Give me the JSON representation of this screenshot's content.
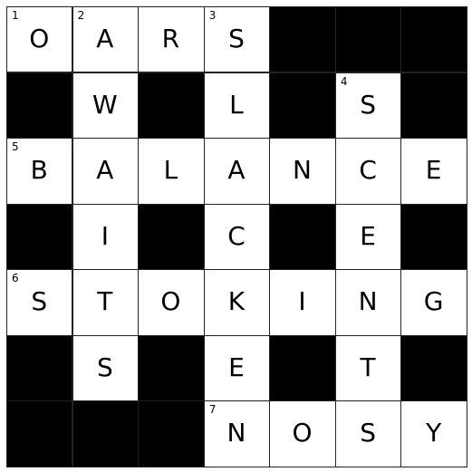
{
  "puzzle": {
    "rows": [
      "OARS###",
      "#W#L#S#",
      "BALANCE",
      "#I#C#E#",
      "STOKING",
      "#S#E#T#",
      "###NOSY"
    ],
    "numbers": [
      {
        "row": 0,
        "col": 0,
        "n": "1"
      },
      {
        "row": 0,
        "col": 1,
        "n": "2"
      },
      {
        "row": 0,
        "col": 3,
        "n": "3"
      },
      {
        "row": 1,
        "col": 5,
        "n": "4"
      },
      {
        "row": 2,
        "col": 0,
        "n": "5"
      },
      {
        "row": 4,
        "col": 0,
        "n": "6"
      },
      {
        "row": 6,
        "col": 3,
        "n": "7"
      }
    ]
  }
}
